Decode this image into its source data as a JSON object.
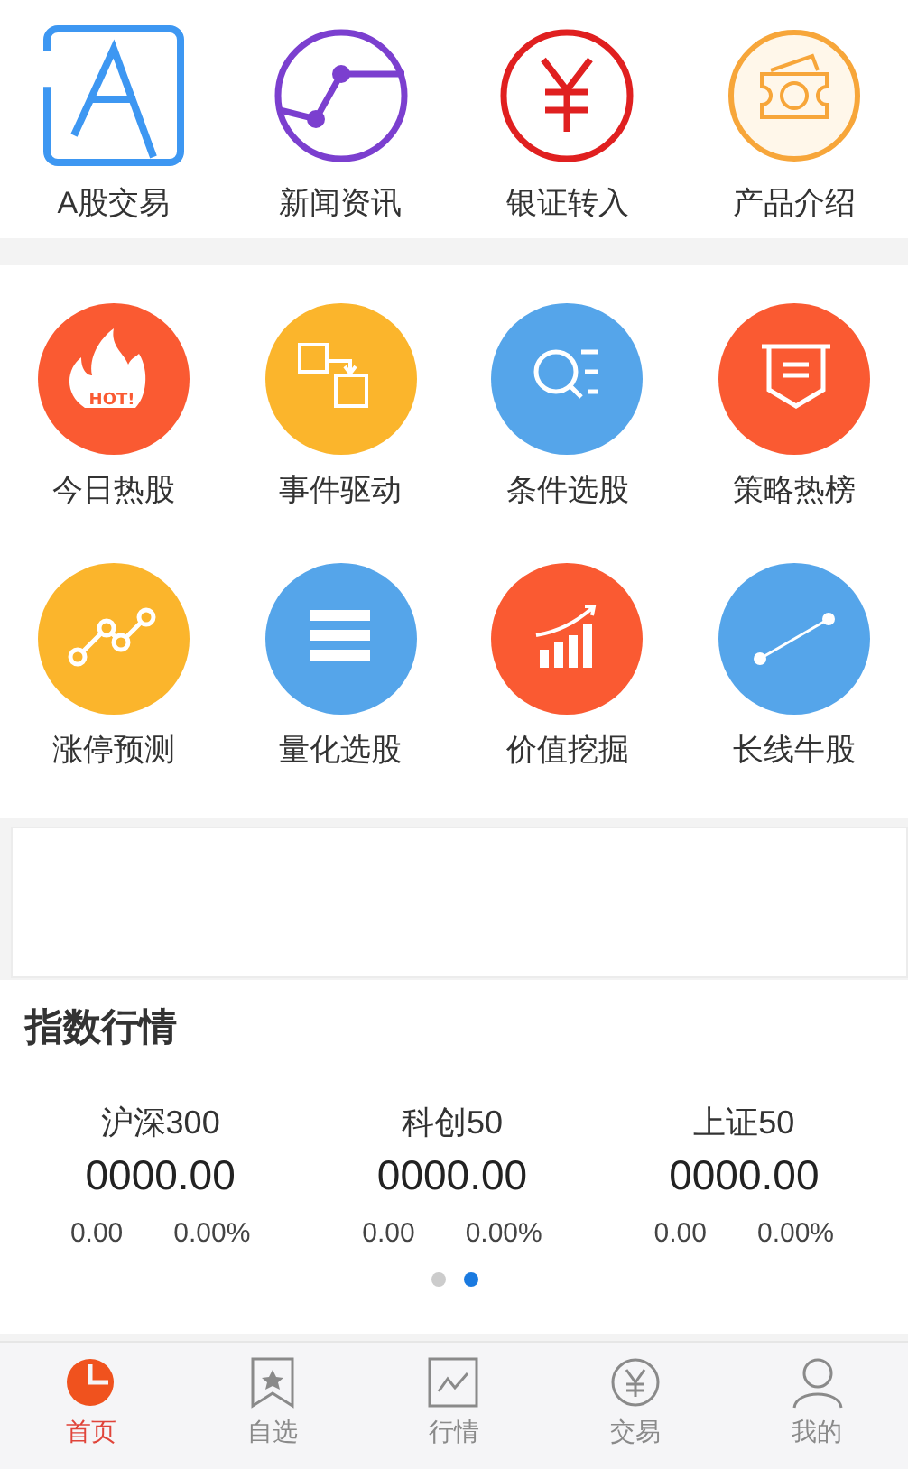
{
  "top_menu": [
    {
      "label": "A股交易"
    },
    {
      "label": "新闻资讯"
    },
    {
      "label": "银证转入"
    },
    {
      "label": "产品介绍"
    }
  ],
  "feature_menu": [
    {
      "label": "今日热股",
      "color": "#fa5a32",
      "badge": "HOT!"
    },
    {
      "label": "事件驱动",
      "color": "#fbb52c"
    },
    {
      "label": "条件选股",
      "color": "#55a5ea"
    },
    {
      "label": "策略热榜",
      "color": "#fa5a32"
    },
    {
      "label": "涨停预测",
      "color": "#fbb52c"
    },
    {
      "label": "量化选股",
      "color": "#55a5ea"
    },
    {
      "label": "价值挖掘",
      "color": "#fa5a32"
    },
    {
      "label": "长线牛股",
      "color": "#55a5ea"
    }
  ],
  "index_section": {
    "title": "指数行情",
    "indices": [
      {
        "name": "沪深300",
        "value": "0000.00",
        "change": "0.00",
        "percent": "0.00%"
      },
      {
        "name": "科创50",
        "value": "0000.00",
        "change": "0.00",
        "percent": "0.00%"
      },
      {
        "name": "上证50",
        "value": "0000.00",
        "change": "0.00",
        "percent": "0.00%"
      }
    ],
    "pages": [
      {
        "selected": false
      },
      {
        "selected": true
      }
    ]
  },
  "tab_bar": [
    {
      "label": "首页",
      "selected": true
    },
    {
      "label": "自选",
      "selected": false
    },
    {
      "label": "行情",
      "selected": false
    },
    {
      "label": "交易",
      "selected": false
    },
    {
      "label": "我的",
      "selected": false
    }
  ]
}
